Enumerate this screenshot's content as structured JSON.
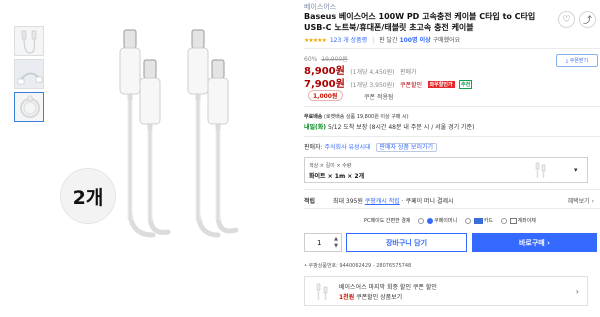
{
  "gallery": {
    "badge": "2개"
  },
  "product": {
    "brand": "베이스어스",
    "title": "Baseus 베이스어스 100W PD 고속충전 케이블 C타입 to C타입 USB-C 노트북/휴대폰/태블릿 초고속 충전 케이블",
    "stars": "★★★★★",
    "rating_count": "123 개 상품평",
    "seller_line_prefix": "판 달간",
    "seller_line_count": "100명 이상",
    "seller_line_suffix": "구매했어요"
  },
  "icons": {
    "heart": "♡",
    "share": "⤴",
    "chevron": "▾",
    "chevron_right": "›"
  },
  "price": {
    "discount_rate": "60%",
    "original": "19,900원",
    "sale_price": "8,900원",
    "sale_unit": "(1개당 4,450원)",
    "sale_label": "판매가",
    "coupon_price": "7,900원",
    "coupon_unit": "(1개당 3,950원)",
    "coupon_label": "쿠폰할인",
    "wow_tag": "와우할인가",
    "green_tag": "추천",
    "coupon_button": "⤓ 쿠폰받기",
    "coupon_chip": "1,000원",
    "coupon_note": "쿠폰 적용됨"
  },
  "shipping": {
    "line1_label": "무료배송",
    "line1_text": "(로켓배송 상품 19,800원 이상 구매 시)",
    "line2_green": "내일(화)",
    "line2_text": "5/12 도착 보장 (8시간 48분 내 주문 시 / 서울 경기 기준)"
  },
  "seller": {
    "label": "판매자:",
    "name": "주식회사 유성시대",
    "other_button": "판매자 상품 보러가기"
  },
  "option": {
    "line1": "색상 × 길이 × 수량",
    "line2": "화이트 × 1m × 2개"
  },
  "points": {
    "label": "적립",
    "text": "최대 395원 ",
    "cash": "쿠팡캐시 적립",
    "suffix": " · 쿠페이 머니 결제시",
    "more": "혜택보기 ›"
  },
  "payment": {
    "label": "PC페이도 간편한 결제",
    "opt1": "쿠페이머니",
    "opt2": "카드",
    "opt3": "계좌이체"
  },
  "actions": {
    "qty": "1",
    "qty_up": "▲",
    "qty_down": "▼",
    "cart": "장바구니 담기",
    "buy": "바로구매 ›"
  },
  "meta": {
    "product_code": "• 쿠팡상품번호: 9440062429 - 28076575748"
  },
  "promo": {
    "line1": "베이스어스 마지막 회종 할인 쿠폰 할인",
    "line2_red": "1천원",
    "line2_text": " 쿠폰할인 상품보기"
  }
}
